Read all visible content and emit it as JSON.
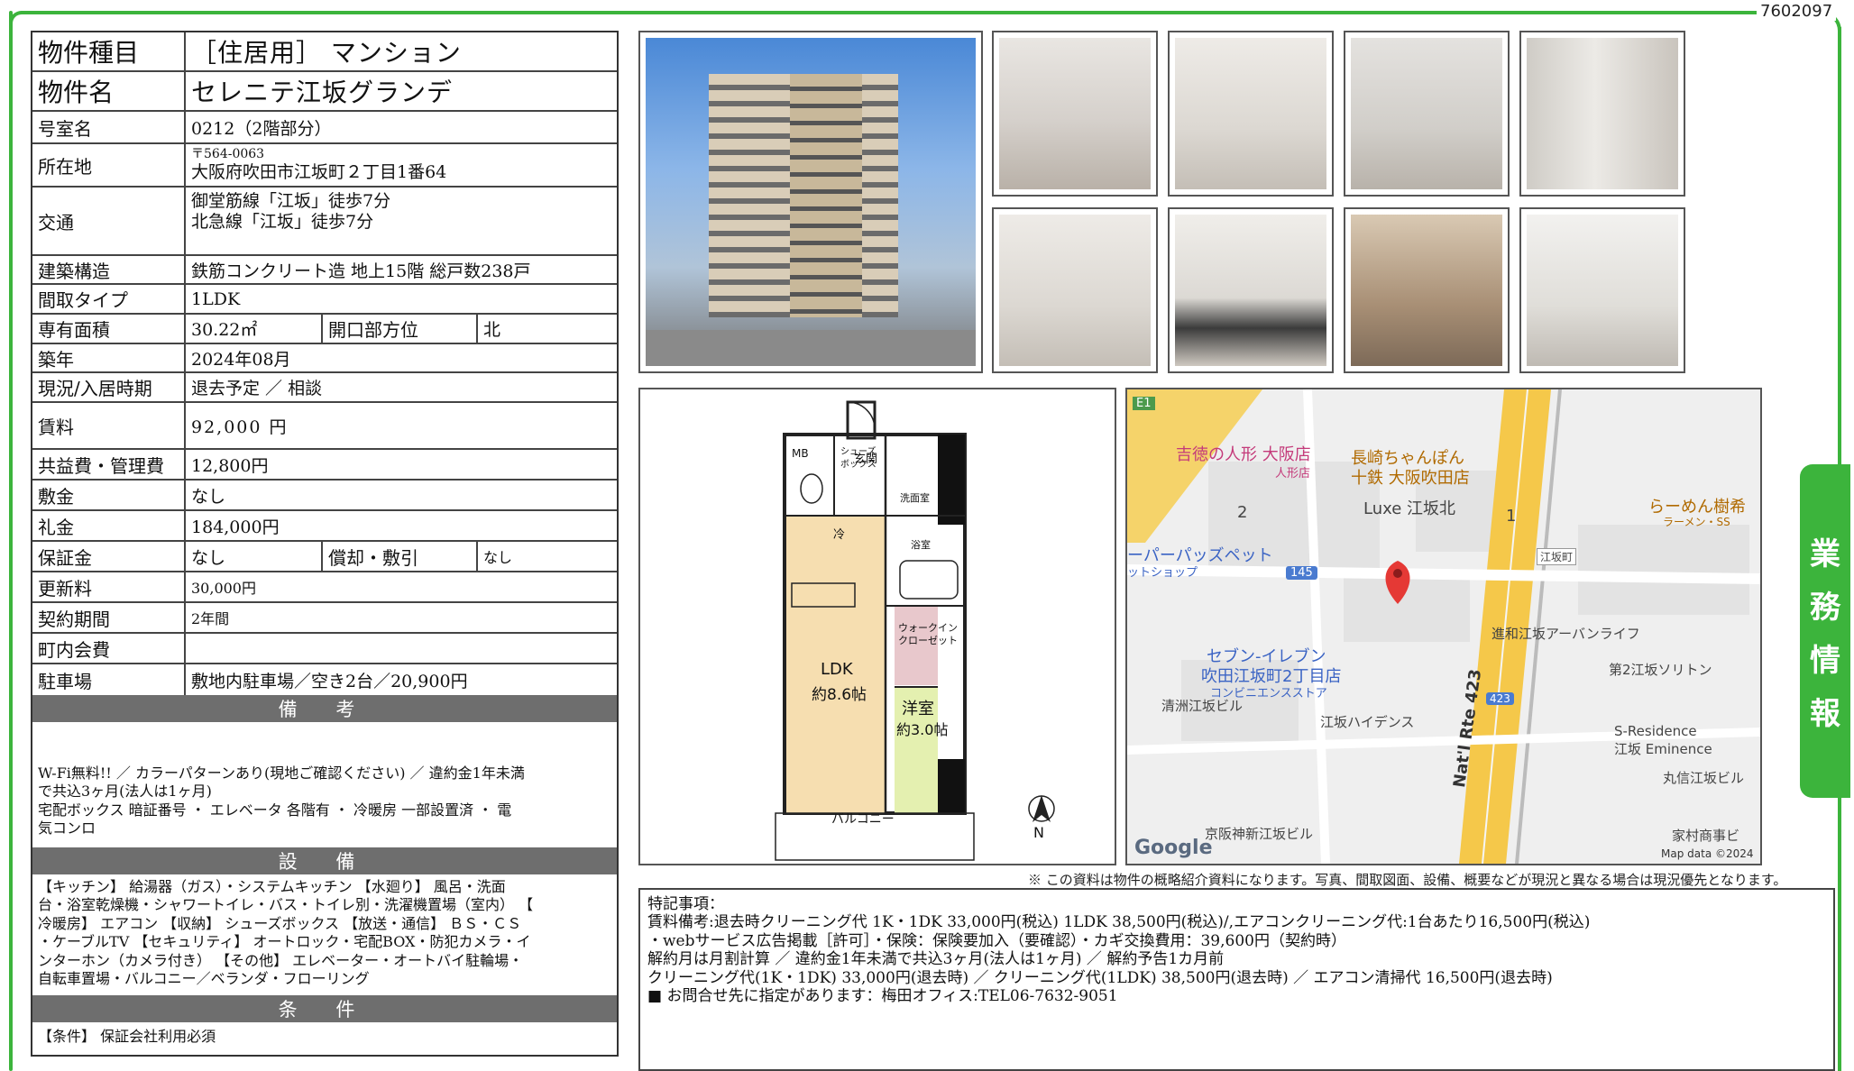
{
  "doc_id": "7602097",
  "side_tab": [
    "業",
    "務",
    "情",
    "報"
  ],
  "property": {
    "type_label": "物件種目",
    "type_value": "［住居用］ マンション",
    "name_label": "物件名",
    "name_value": "セレニテ江坂グランデ",
    "room_label": "号室名",
    "room_value": "0212（2階部分）",
    "address_label": "所在地",
    "postal": "〒564-0063",
    "address": "大阪府吹田市江坂町２丁目1番64",
    "traffic_label": "交通",
    "traffic_1": "御堂筋線「江坂」徒歩7分",
    "traffic_2": "北急線「江坂」徒歩7分",
    "structure_label": "建築構造",
    "structure_value": "鉄筋コンクリート造 地上15階 総戸数238戸",
    "layout_label": "間取タイプ",
    "layout_value": "1LDK",
    "area_label": "専有面積",
    "area_value": "30.22㎡",
    "direction_label": "開口部方位",
    "direction_value": "北",
    "built_label": "築年",
    "built_value": "2024年08月",
    "status_label": "現況/入居時期",
    "status_value": "退去予定 ／ 相談",
    "rent_label": "賃料",
    "rent_value": "92,000 円",
    "fee_label": "共益費・管理費",
    "fee_value": "12,800円",
    "deposit_label": "敷金",
    "deposit_value": "なし",
    "key_money_label": "礼金",
    "key_money_value": "184,000円",
    "guarantee_label": "保証金",
    "guarantee_value": "なし",
    "amortization_label": "償却・敷引",
    "amortization_value": "なし",
    "renewal_label": "更新料",
    "renewal_value": "30,000円",
    "contract_label": "契約期間",
    "contract_value": "2年間",
    "association_label": "町内会費",
    "association_value": "",
    "parking_label": "駐車場",
    "parking_value": "敷地内駐車場／空き2台／20,900円"
  },
  "remarks": {
    "heading": "備 考",
    "line1": "W-Fi無料!! ／ カラーパターンあり(現地ご確認ください) ／ 違約金1年未満",
    "line2": "で共込3ヶ月(法人は1ヶ月)",
    "line3": "宅配ボックス 暗証番号 ・ エレベータ 各階有 ・ 冷暖房 一部設置済 ・ 電",
    "line4": "気コンロ"
  },
  "equipment": {
    "heading": "設 備",
    "line1": "【キッチン】 給湯器（ガス）・システムキッチン 【水廻り】 風呂・洗面",
    "line2": "台・浴室乾燥機・シャワートイレ・バス・トイレ別・洗濯機置場（室内） 【",
    "line3": "冷暖房】 エアコン 【収納】 シューズボックス 【放送・通信】 ＢＳ・ＣＳ",
    "line4": "・ケーブルTV 【セキュリティ】 オートロック・宅配BOX・防犯カメラ・イ",
    "line5": "ンターホン（カメラ付き） 【その他】 エレベーター・オートバイ駐輪場・",
    "line6": "自転車置場・バルコニー／ベランダ・フローリング"
  },
  "conditions": {
    "heading": "条 件",
    "line1": "【条件】 保証会社利用必須"
  },
  "floorplan": {
    "mb": "MB",
    "shoes": "シューズ",
    "box": "ボックス",
    "entrance": "玄関",
    "laundry": "洗面室",
    "cold": "冷",
    "bath": "浴室",
    "wic_1": "ウォークイン",
    "wic_2": "クローゼット",
    "ldk": "LDK",
    "ldk_size": "約8.6帖",
    "western": "洋室",
    "western_size": "約3.0帖",
    "balcony": "バルコニー",
    "north": "N"
  },
  "map": {
    "route_e1": "E1",
    "label_yoshitoku": "吉徳の人形 大阪店",
    "label_ningyo": "人形店",
    "label_nagasaki_1": "長崎ちゃんぽん",
    "label_nagasaki_2": "十鉄 大阪吹田店",
    "label_luxe": "Luxe 江坂北",
    "label_2": "2",
    "label_1": "1",
    "label_ramen": "らーめん樹希",
    "label_ramen_sub": "ラーメン・SS",
    "label_pets": "ーパーパッズペット",
    "label_pets_sub": "ットショップ",
    "label_145": "145",
    "label_esaka_machi": "江坂町",
    "label_seven_1": "セブン-イレブン",
    "label_seven_2": "吹田江坂町2丁目店",
    "label_seven_3": "コンビニエンスストア",
    "label_shinwa": "進和江坂アーバンライフ",
    "label_sorriton": "第2江坂ソリトン",
    "label_kiyosu": "清洲江坂ビル",
    "label_heights": "江坂ハイデンス",
    "label_423": "423",
    "label_route": "Nat'l Rte 423",
    "label_sres_1": "S-Residence",
    "label_sres_2": "江坂 Eminence",
    "label_marushin": "丸信江坂ビル",
    "label_keihan": "京阪神新江坂ビル",
    "label_iemura": "家村商事ビ",
    "google": "Google",
    "map_data": "Map data ©2024"
  },
  "notice": "※ この資料は物件の概略紹介資料になります。写真、間取図面、設備、概要などが現況と異なる場合は現況優先となります。",
  "special": {
    "line1": "特記事項：",
    "line2": "賃料備考:退去時クリーニング代 1K・1DK 33,000円(税込) 1LDK 38,500円(税込)/,エアコンクリーニング代:1台あたり16,500円(税込)",
    "line3": "・webサービス広告掲載［許可］・保険：保険要加入（要確認）・カギ交換費用：39,600円（契約時）",
    "line4": "解約月は月割計算 ／ 違約金1年未満で共込3ヶ月(法人は1ヶ月) ／ 解約予告1カ月前",
    "line5": "クリーニング代(1K・1DK) 33,000円(退去時) ／ クリーニング代(1LDK) 38,500円(退去時) ／ エアコン清掃代 16,500円(退去時)",
    "line6": "■ お問合せ先に指定があります：梅田オフィス:TEL06-7632-9051"
  },
  "colors": {
    "frame": "#3cb43c",
    "section_header": "#6e6e6e"
  }
}
